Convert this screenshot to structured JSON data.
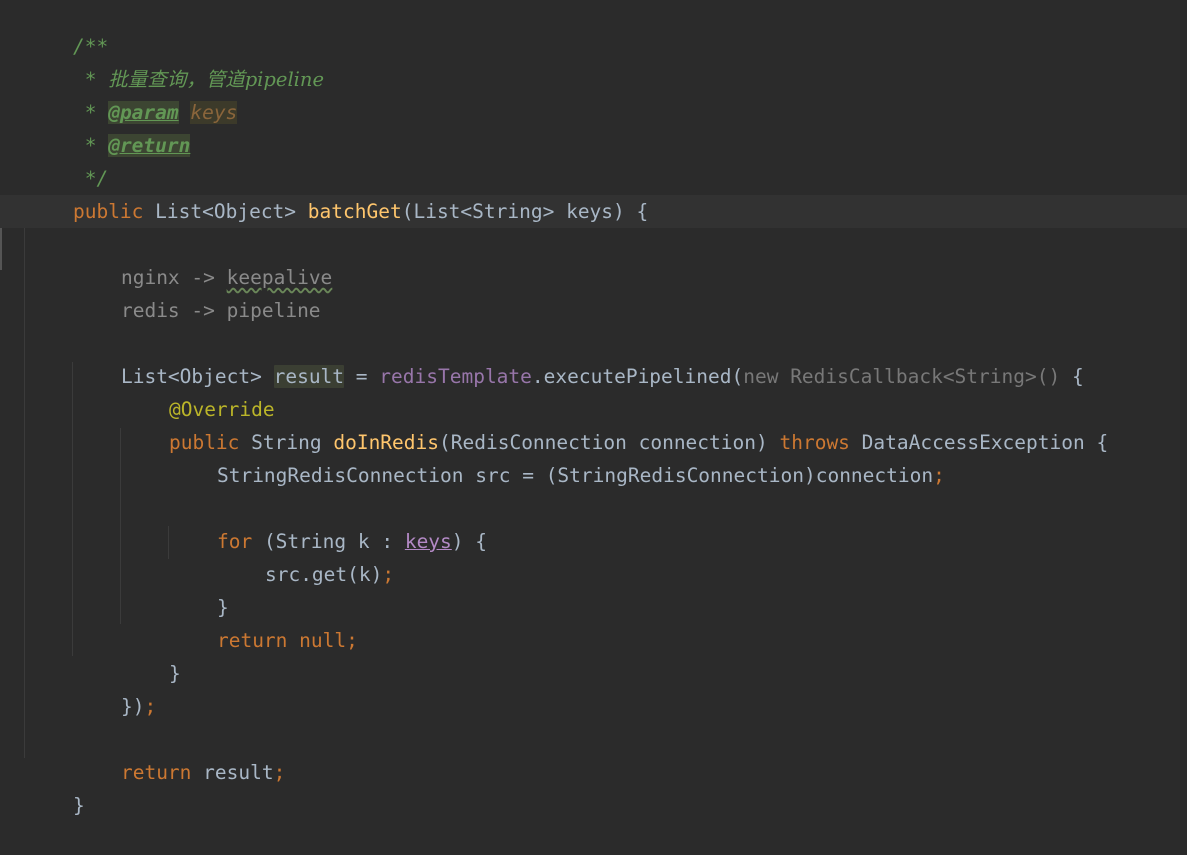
{
  "editor": {
    "language": "Java",
    "colors": {
      "background": "#2b2b2b",
      "keyword": "#cc7832",
      "method": "#ffc66d",
      "field": "#9876aa",
      "annotation": "#bbb529",
      "doc_comment": "#629755",
      "text": "#a9b7c6"
    },
    "code": {
      "l1_doc_open": "/**",
      "l2_star": " * ",
      "l2_text": "批量查询，管道pipeline",
      "l3_star": " * ",
      "l3_tag": "@param",
      "l3_sp": " ",
      "l3_param": "keys",
      "l4_star": " * ",
      "l4_tag": "@return",
      "l5_close": " */",
      "l6_kw_public": "public",
      "l6_type": " List<Object> ",
      "l6_method": "batchGet",
      "l6_params": "(List<String> keys) {",
      "l8_hint_a": "nginx -> ",
      "l8_hint_b": "keepalive",
      "l9_hint": "redis -> pipeline",
      "l11_type": "List<Object> ",
      "l11_var": "result",
      "l11_eq": " = ",
      "l11_field": "redisTemplate",
      "l11_call": ".executePipelined(",
      "l11_new": "new RedisCallback<String>()",
      "l11_brace": " {",
      "l12_anno": "@Override",
      "l13_kw_public": "public",
      "l13_type": " String ",
      "l13_method": "doInRedis",
      "l13_params": "(RedisConnection connection) ",
      "l13_throws": "throws",
      "l13_exc": " DataAccessException {",
      "l14_stmt": "StringRedisConnection src = (StringRedisConnection)connection",
      "l14_semi": ";",
      "l16_kw_for": "for",
      "l16_a": " (String k : ",
      "l16_keys": "keys",
      "l16_b": ") {",
      "l17_stmt": "src.get(k)",
      "l17_semi": ";",
      "l18_close": "}",
      "l19_kw_return": "return null",
      "l19_semi": ";",
      "l20_close": "}",
      "l21_close": "})",
      "l21_semi": ";",
      "l23_kw_return": "return",
      "l23_val": " result",
      "l23_semi": ";",
      "l24_close": "}"
    }
  }
}
